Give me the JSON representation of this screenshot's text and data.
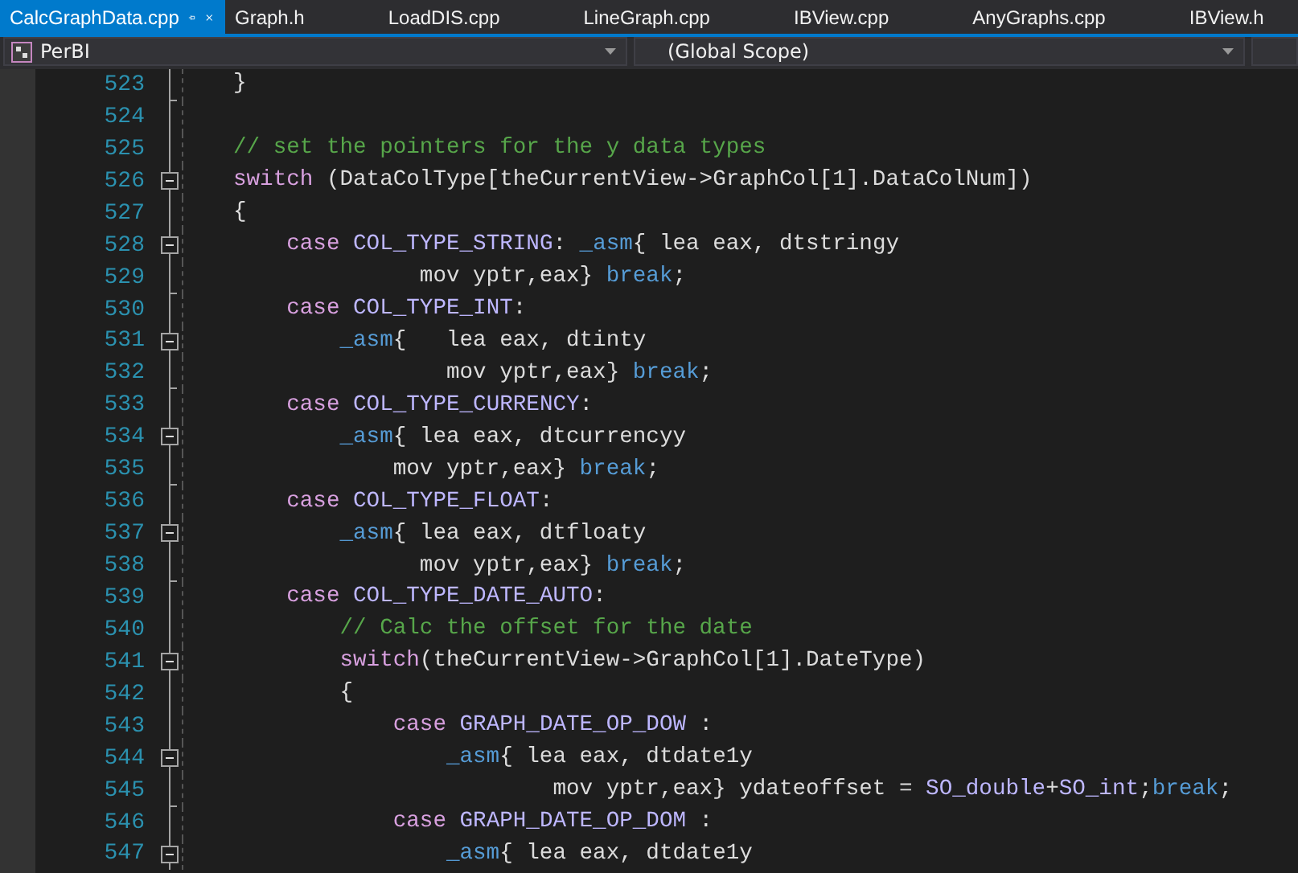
{
  "tabs": [
    {
      "label": "CalcGraphData.cpp",
      "selected": true,
      "pinned": true
    },
    {
      "label": "Graph.h",
      "selected": false,
      "pinned": false
    },
    {
      "label": "LoadDIS.cpp",
      "selected": false,
      "pinned": false
    },
    {
      "label": "LineGraph.cpp",
      "selected": false,
      "pinned": false
    },
    {
      "label": "IBView.cpp",
      "selected": false,
      "pinned": false
    },
    {
      "label": "AnyGraphs.cpp",
      "selected": false,
      "pinned": false
    },
    {
      "label": "IBView.h",
      "selected": false,
      "pinned": false
    }
  ],
  "navigation": {
    "project": "PerBI",
    "scope": "(Global Scope)"
  },
  "lines": [
    {
      "number": "523",
      "fold": false,
      "fold_end": true,
      "tokens": [
        {
          "kind": "plain",
          "text": "}"
        }
      ]
    },
    {
      "number": "524",
      "fold": false,
      "fold_end": false
    },
    {
      "number": "525",
      "fold": false,
      "fold_end": false,
      "tokens": [
        {
          "kind": "comment",
          "text": "// set the pointers for the y data types"
        }
      ]
    },
    {
      "number": "526",
      "fold": true,
      "fold_end": false,
      "tokens": [
        {
          "kind": "keyword",
          "text": "switch"
        },
        {
          "kind": "plain",
          "text": " (DataColType[theCurrentView->GraphCol[1].DataColNum])"
        }
      ]
    },
    {
      "number": "527",
      "fold": false,
      "fold_end": false,
      "tokens": [
        {
          "kind": "plain",
          "text": "{"
        }
      ]
    },
    {
      "number": "528",
      "fold": true,
      "fold_end": false,
      "tokens": [
        {
          "kind": "keyword",
          "text": "    case"
        },
        {
          "kind": "macro",
          "text": " COL_TYPE_STRING"
        },
        {
          "kind": "plain",
          "text": ":"
        },
        {
          "kind": "asm",
          "text": " _asm"
        },
        {
          "kind": "plain",
          "text": "{ lea eax, dtstringy"
        }
      ]
    },
    {
      "number": "529",
      "fold": false,
      "fold_end": true,
      "tokens": [
        {
          "kind": "plain",
          "text": "              mov yptr,eax}"
        },
        {
          "kind": "asm",
          "text": " break"
        },
        {
          "kind": "plain",
          "text": ";"
        }
      ]
    },
    {
      "number": "530",
      "fold": false,
      "fold_end": false,
      "tokens": [
        {
          "kind": "keyword",
          "text": "    case"
        },
        {
          "kind": "macro",
          "text": " COL_TYPE_INT"
        },
        {
          "kind": "plain",
          "text": ":"
        }
      ]
    },
    {
      "number": "531",
      "fold": true,
      "fold_end": false,
      "tokens": [
        {
          "kind": "asm",
          "text": "        _asm"
        },
        {
          "kind": "plain",
          "text": "{   lea eax, dtinty"
        }
      ]
    },
    {
      "number": "532",
      "fold": false,
      "fold_end": true,
      "tokens": [
        {
          "kind": "plain",
          "text": "                mov yptr,eax}"
        },
        {
          "kind": "asm",
          "text": " break"
        },
        {
          "kind": "plain",
          "text": ";"
        }
      ]
    },
    {
      "number": "533",
      "fold": false,
      "fold_end": false,
      "tokens": [
        {
          "kind": "keyword",
          "text": "    case"
        },
        {
          "kind": "macro",
          "text": " COL_TYPE_CURRENCY"
        },
        {
          "kind": "plain",
          "text": ":"
        }
      ]
    },
    {
      "number": "534",
      "fold": true,
      "fold_end": false,
      "tokens": [
        {
          "kind": "asm",
          "text": "        _asm"
        },
        {
          "kind": "plain",
          "text": "{ lea eax, dtcurrencyy"
        }
      ]
    },
    {
      "number": "535",
      "fold": false,
      "fold_end": true,
      "tokens": [
        {
          "kind": "plain",
          "text": "            mov yptr,eax}"
        },
        {
          "kind": "asm",
          "text": " break"
        },
        {
          "kind": "plain",
          "text": ";"
        }
      ]
    },
    {
      "number": "536",
      "fold": false,
      "fold_end": false,
      "tokens": [
        {
          "kind": "keyword",
          "text": "    case"
        },
        {
          "kind": "macro",
          "text": " COL_TYPE_FLOAT"
        },
        {
          "kind": "plain",
          "text": ":"
        }
      ]
    },
    {
      "number": "537",
      "fold": true,
      "fold_end": false,
      "tokens": [
        {
          "kind": "asm",
          "text": "        _asm"
        },
        {
          "kind": "plain",
          "text": "{ lea eax, dtfloaty"
        }
      ]
    },
    {
      "number": "538",
      "fold": false,
      "fold_end": true,
      "tokens": [
        {
          "kind": "plain",
          "text": "              mov yptr,eax}"
        },
        {
          "kind": "asm",
          "text": " break"
        },
        {
          "kind": "plain",
          "text": ";"
        }
      ]
    },
    {
      "number": "539",
      "fold": false,
      "fold_end": false,
      "tokens": [
        {
          "kind": "keyword",
          "text": "    case"
        },
        {
          "kind": "macro",
          "text": " COL_TYPE_DATE_AUTO"
        },
        {
          "kind": "plain",
          "text": ":"
        }
      ]
    },
    {
      "number": "540",
      "fold": false,
      "fold_end": false,
      "tokens": [
        {
          "kind": "comment",
          "text": "        // Calc the offset for the date"
        }
      ]
    },
    {
      "number": "541",
      "fold": true,
      "fold_end": false,
      "tokens": [
        {
          "kind": "keyword",
          "text": "        switch"
        },
        {
          "kind": "plain",
          "text": "(theCurrentView->GraphCol[1].DateType)"
        }
      ]
    },
    {
      "number": "542",
      "fold": false,
      "fold_end": false,
      "tokens": [
        {
          "kind": "plain",
          "text": "        {"
        }
      ]
    },
    {
      "number": "543",
      "fold": false,
      "fold_end": false,
      "tokens": [
        {
          "kind": "keyword",
          "text": "            case"
        },
        {
          "kind": "macro",
          "text": " GRAPH_DATE_OP_DOW"
        },
        {
          "kind": "plain",
          "text": " :"
        }
      ]
    },
    {
      "number": "544",
      "fold": true,
      "fold_end": false,
      "tokens": [
        {
          "kind": "asm",
          "text": "                _asm"
        },
        {
          "kind": "plain",
          "text": "{ lea eax, dtdate1y"
        }
      ]
    },
    {
      "number": "545",
      "fold": false,
      "fold_end": true,
      "tokens": [
        {
          "kind": "plain",
          "text": "                        mov yptr,eax} ydateoffset ="
        },
        {
          "kind": "macro",
          "text": " SO_double"
        },
        {
          "kind": "plain",
          "text": "+"
        },
        {
          "kind": "macro",
          "text": "SO_int"
        },
        {
          "kind": "plain",
          "text": ";"
        },
        {
          "kind": "asm",
          "text": "break"
        },
        {
          "kind": "plain",
          "text": ";"
        }
      ]
    },
    {
      "number": "546",
      "fold": false,
      "fold_end": false,
      "tokens": [
        {
          "kind": "keyword",
          "text": "            case"
        },
        {
          "kind": "macro",
          "text": " GRAPH_DATE_OP_DOM"
        },
        {
          "kind": "plain",
          "text": " :"
        }
      ]
    },
    {
      "number": "547",
      "fold": true,
      "fold_end": false,
      "tokens": [
        {
          "kind": "asm",
          "text": "                _asm"
        },
        {
          "kind": "plain",
          "text": "{ lea eax, dtdate1y"
        }
      ]
    }
  ]
}
